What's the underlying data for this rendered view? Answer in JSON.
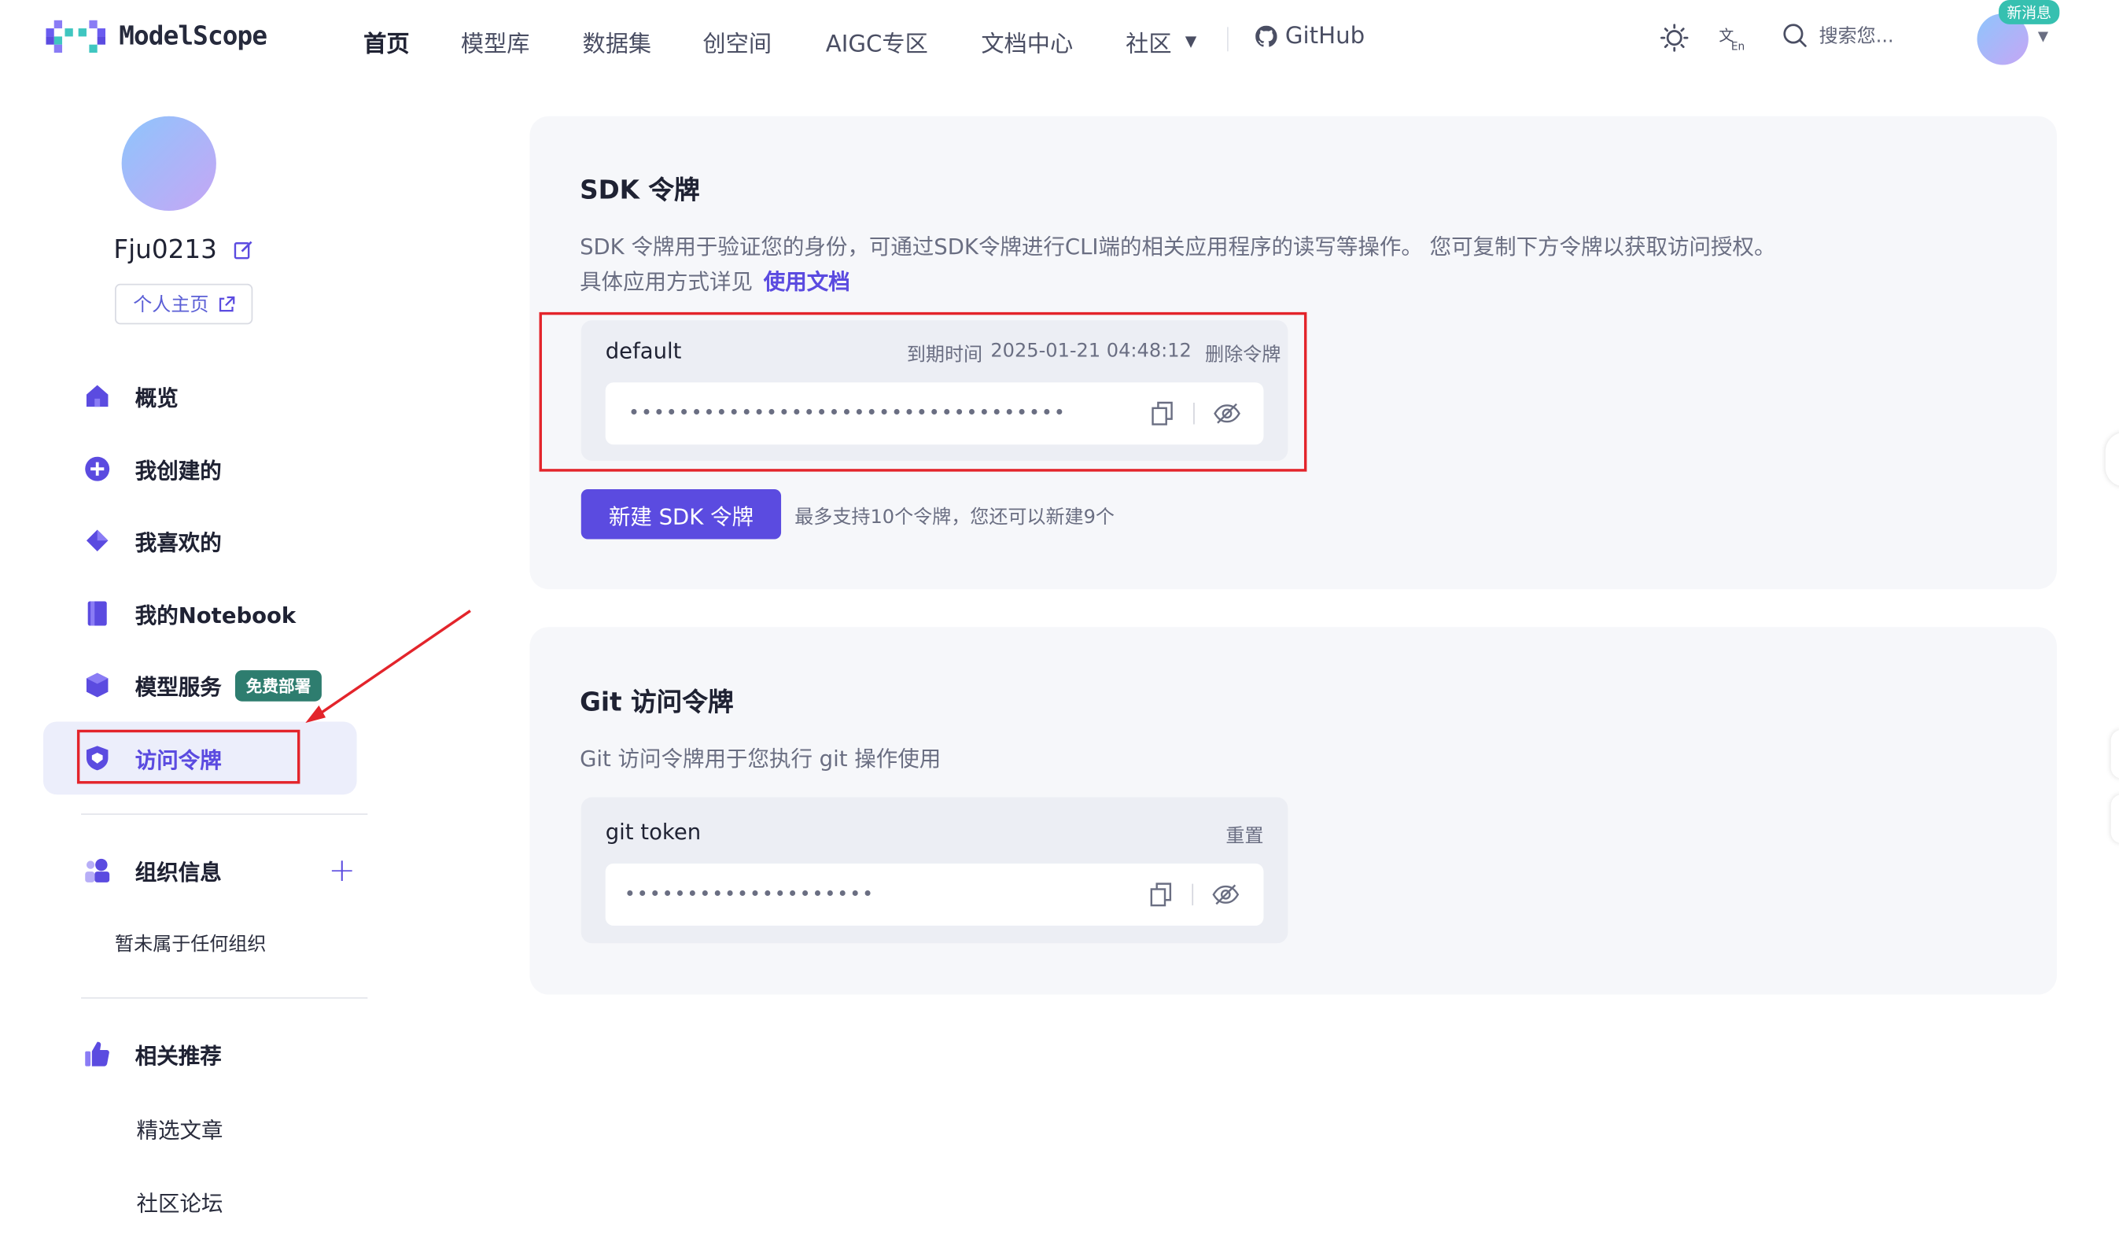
{
  "header": {
    "logo_text": "ModelScope",
    "nav": [
      "首页",
      "模型库",
      "数据集",
      "创空间",
      "AIGC专区",
      "文档中心",
      "社区"
    ],
    "github": "GitHub",
    "search_placeholder": "搜索您...",
    "new_badge": "新消息"
  },
  "sidebar": {
    "username": "Fju0213",
    "home_btn": "个人主页",
    "items": [
      {
        "label": "概览",
        "icon": "home-icon"
      },
      {
        "label": "我创建的",
        "icon": "plus-circle-icon"
      },
      {
        "label": "我喜欢的",
        "icon": "diamond-icon"
      },
      {
        "label": "我的Notebook",
        "icon": "notebook-icon"
      },
      {
        "label": "模型服务",
        "icon": "cube-icon",
        "badge": "免费部署"
      },
      {
        "label": "访问令牌",
        "icon": "shield-icon",
        "active": true
      }
    ],
    "org_title": "组织信息",
    "org_empty": "暂未属于任何组织",
    "rec_title": "相关推荐",
    "rec_items": [
      "精选文章",
      "社区论坛"
    ]
  },
  "sdk": {
    "title": "SDK 令牌",
    "desc_line1": "SDK 令牌用于验证您的身份，可通过SDK令牌进行CLI端的相关应用程序的读写等操作。 您可复制下方令牌以获取访问授权。",
    "desc_line2": "具体应用方式详见",
    "doc_link": "使用文档",
    "token_name": "default",
    "expire_label": "到期时间",
    "expire_value": "2025-01-21 04:48:12",
    "delete_label": "删除令牌",
    "masked": "•••••••••••••••••••••••••••••••••••",
    "new_btn": "新建 SDK 令牌",
    "limit_hint": "最多支持10个令牌，您还可以新建9个"
  },
  "git": {
    "title": "Git 访问令牌",
    "desc": "Git 访问令牌用于您执行 git 操作使用",
    "token_name": "git token",
    "reset_label": "重置",
    "masked": "••••••••••••••••••••"
  },
  "colors": {
    "accent": "#5b4be0",
    "annotation": "#e3242b",
    "badge_teal": "#36c0b0",
    "badge_green": "#2e7d6f"
  }
}
